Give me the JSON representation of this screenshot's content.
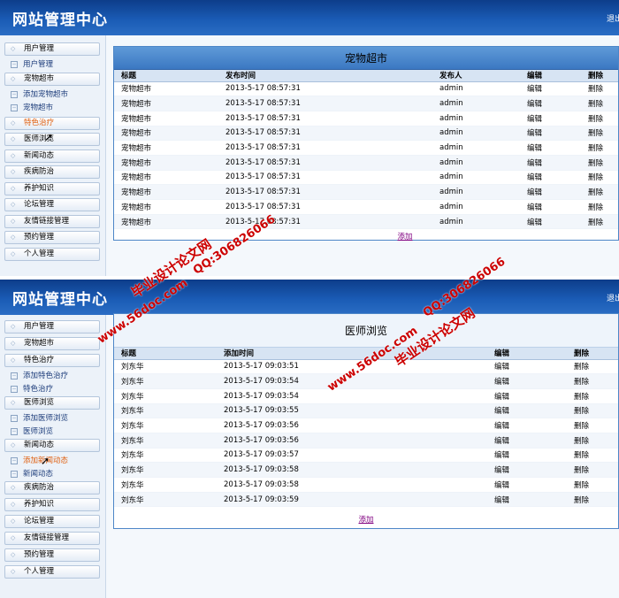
{
  "app": {
    "title": "网站管理中心",
    "logout": "退出"
  },
  "panel1": {
    "menu": [
      {
        "label": "用户管理"
      },
      {
        "label": "用户管理",
        "type": "sub"
      },
      {
        "label": "宠物超市"
      },
      {
        "label": "添加宠物超市",
        "type": "sub"
      },
      {
        "label": "宠物超市",
        "type": "sub"
      },
      {
        "label": "特色治疗",
        "highlight": true
      },
      {
        "label": "医师浏览"
      },
      {
        "label": "新闻动态"
      },
      {
        "label": "疾病防治"
      },
      {
        "label": "养护知识"
      },
      {
        "label": "论坛管理"
      },
      {
        "label": "友情链接管理"
      },
      {
        "label": "预约管理"
      },
      {
        "label": "个人管理"
      }
    ],
    "table": {
      "title": "宠物超市",
      "headers": [
        "标题",
        "发布时间",
        "发布人",
        "编辑",
        "删除"
      ],
      "rows": [
        [
          "宠物超市",
          "2013-5-17 08:57:31",
          "admin",
          "编辑",
          "删除"
        ],
        [
          "宠物超市",
          "2013-5-17 08:57:31",
          "admin",
          "编辑",
          "删除"
        ],
        [
          "宠物超市",
          "2013-5-17 08:57:31",
          "admin",
          "编辑",
          "删除"
        ],
        [
          "宠物超市",
          "2013-5-17 08:57:31",
          "admin",
          "编辑",
          "删除"
        ],
        [
          "宠物超市",
          "2013-5-17 08:57:31",
          "admin",
          "编辑",
          "删除"
        ],
        [
          "宠物超市",
          "2013-5-17 08:57:31",
          "admin",
          "编辑",
          "删除"
        ],
        [
          "宠物超市",
          "2013-5-17 08:57:31",
          "admin",
          "编辑",
          "删除"
        ],
        [
          "宠物超市",
          "2013-5-17 08:57:31",
          "admin",
          "编辑",
          "删除"
        ],
        [
          "宠物超市",
          "2013-5-17 08:57:31",
          "admin",
          "编辑",
          "删除"
        ],
        [
          "宠物超市",
          "2013-5-17 08:57:31",
          "admin",
          "编辑",
          "删除"
        ]
      ],
      "add_label": "添加"
    }
  },
  "panel2": {
    "menu": [
      {
        "label": "用户管理"
      },
      {
        "label": "宠物超市"
      },
      {
        "label": "特色治疗"
      },
      {
        "label": "添加特色治疗",
        "type": "sub"
      },
      {
        "label": "特色治疗",
        "type": "sub"
      },
      {
        "label": "医师浏览"
      },
      {
        "label": "添加医师浏览",
        "type": "sub"
      },
      {
        "label": "医师浏览",
        "type": "sub"
      },
      {
        "label": "新闻动态"
      },
      {
        "label": "添加新闻动态",
        "type": "sub",
        "highlight": true
      },
      {
        "label": "新闻动态",
        "type": "sub"
      },
      {
        "label": "疾病防治"
      },
      {
        "label": "养护知识"
      },
      {
        "label": "论坛管理"
      },
      {
        "label": "友情链接管理"
      },
      {
        "label": "预约管理"
      },
      {
        "label": "个人管理"
      }
    ],
    "table": {
      "title": "医师浏览",
      "headers": [
        "标题",
        "添加时间",
        "编辑",
        "删除"
      ],
      "rows": [
        [
          "刘东华",
          "2013-5-17 09:03:51",
          "编辑",
          "删除"
        ],
        [
          "刘东华",
          "2013-5-17 09:03:54",
          "编辑",
          "删除"
        ],
        [
          "刘东华",
          "2013-5-17 09:03:54",
          "编辑",
          "删除"
        ],
        [
          "刘东华",
          "2013-5-17 09:03:55",
          "编辑",
          "删除"
        ],
        [
          "刘东华",
          "2013-5-17 09:03:56",
          "编辑",
          "删除"
        ],
        [
          "刘东华",
          "2013-5-17 09:03:56",
          "编辑",
          "删除"
        ],
        [
          "刘东华",
          "2013-5-17 09:03:57",
          "编辑",
          "删除"
        ],
        [
          "刘东华",
          "2013-5-17 09:03:58",
          "编辑",
          "删除"
        ],
        [
          "刘东华",
          "2013-5-17 09:03:58",
          "编辑",
          "删除"
        ],
        [
          "刘东华",
          "2013-5-17 09:03:59",
          "编辑",
          "删除"
        ]
      ],
      "add_label": "添加"
    }
  },
  "watermarks": {
    "site": "www.56doc.com",
    "qq": "QQ:306826066",
    "name": "毕业设计论文网"
  }
}
